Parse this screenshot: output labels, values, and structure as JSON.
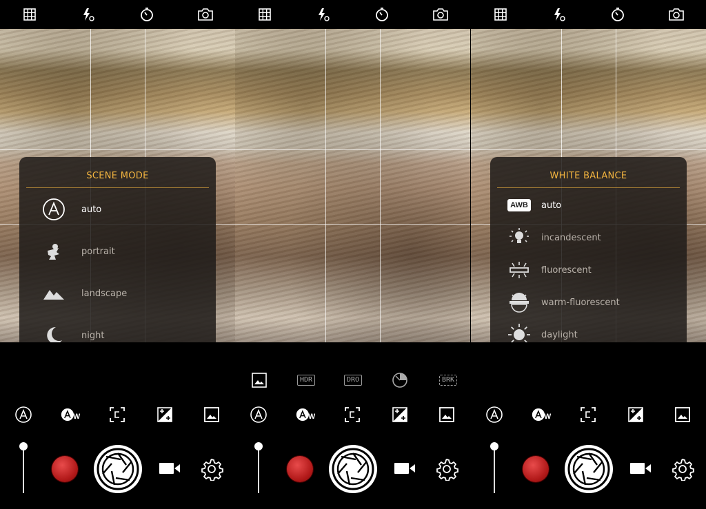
{
  "panels": [
    {
      "id": "scene",
      "menu": {
        "title": "SCENE MODE",
        "items": [
          {
            "label": "auto",
            "icon": "auto-mode-icon"
          },
          {
            "label": "portrait",
            "icon": "portrait-icon"
          },
          {
            "label": "landscape",
            "icon": "landscape-icon"
          },
          {
            "label": "night",
            "icon": "night-icon"
          }
        ]
      }
    },
    {
      "id": "hdr",
      "modes": [
        {
          "label": "",
          "icon": "image-icon"
        },
        {
          "label": "HDR",
          "icon": "hdr-icon"
        },
        {
          "label": "DRO",
          "icon": "dro-icon"
        },
        {
          "label": "",
          "icon": "expo-timer-icon"
        },
        {
          "label": "BRK",
          "icon": "bracket-icon"
        }
      ]
    },
    {
      "id": "wb",
      "menu": {
        "title": "WHITE BALANCE",
        "items": [
          {
            "label": "auto",
            "icon": "awb-icon",
            "badge": "AWB"
          },
          {
            "label": "incandescent",
            "icon": "bulb-icon"
          },
          {
            "label": "fluorescent",
            "icon": "fluorescent-icon"
          },
          {
            "label": "warm-fluorescent",
            "icon": "warm-fluorescent-icon"
          },
          {
            "label": "daylight",
            "icon": "sun-icon"
          }
        ]
      }
    }
  ],
  "topbar": [
    "grid-icon",
    "flash-auto-icon",
    "timer-icon",
    "switch-camera-icon"
  ],
  "toolbar": {
    "awb_badge": "W",
    "items": [
      "scene-mode-icon",
      "white-balance-icon",
      "focus-icon",
      "exposure-icon",
      "photo-mode-icon"
    ]
  },
  "colors": {
    "accent": "#f4b53f",
    "record": "#c62121",
    "background": "#000000"
  }
}
